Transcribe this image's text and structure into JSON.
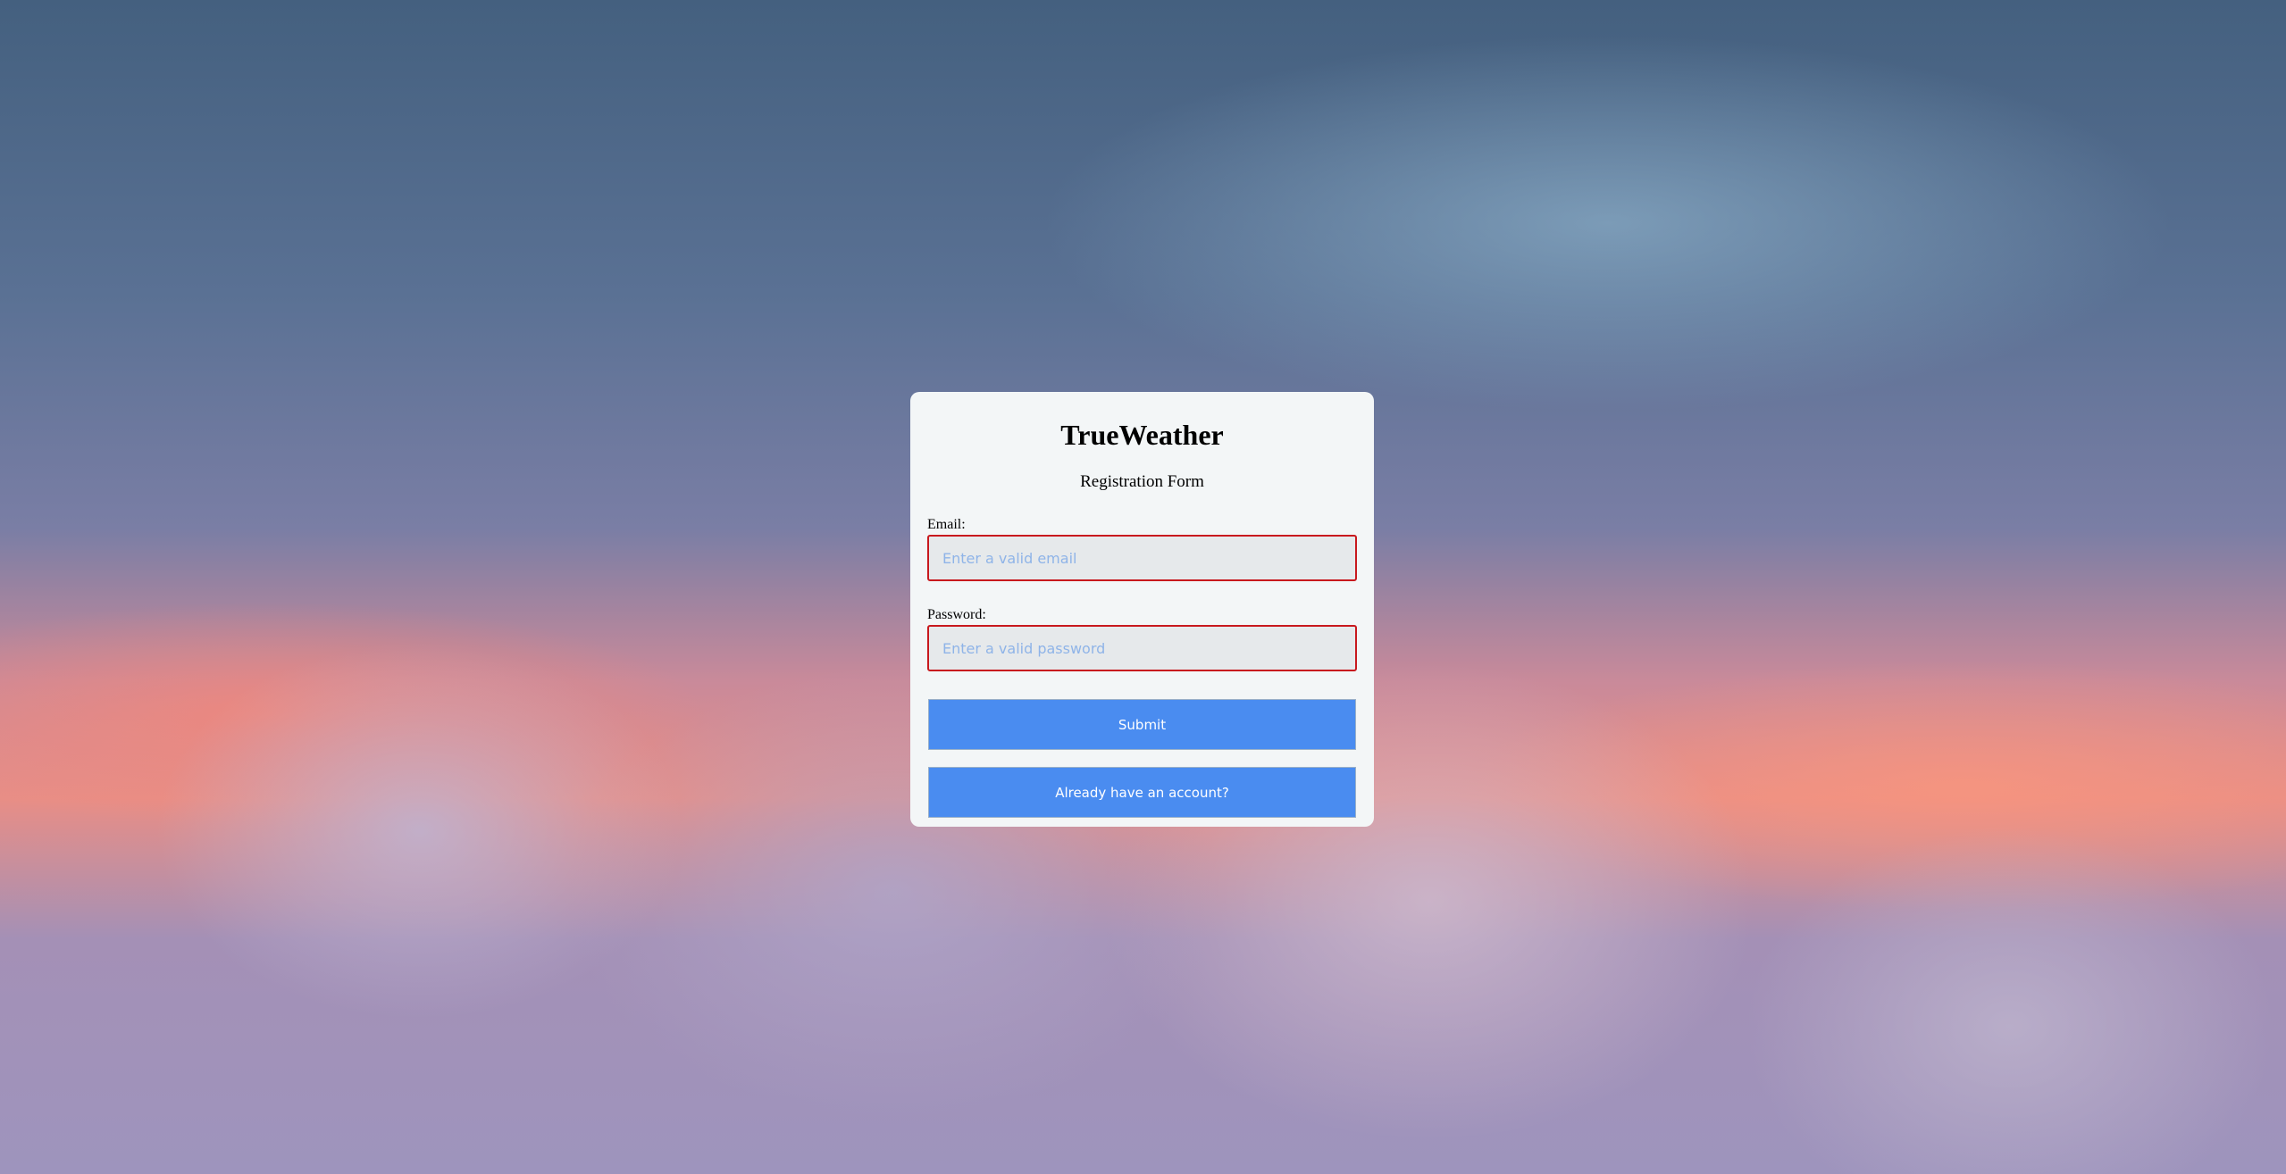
{
  "app": {
    "title": "TrueWeather",
    "subtitle": "Registration Form"
  },
  "form": {
    "email": {
      "label": "Email:",
      "value": "",
      "placeholder": "Enter a valid email"
    },
    "password": {
      "label": "Password:",
      "value": "",
      "placeholder": "Enter a valid password"
    },
    "submit_label": "Submit",
    "login_link_label": "Already have an account?"
  },
  "colors": {
    "button": "#4a8cf0",
    "error_border": "#c8191e",
    "card": "#f3f6f7",
    "placeholder": "#8fb4e8"
  }
}
